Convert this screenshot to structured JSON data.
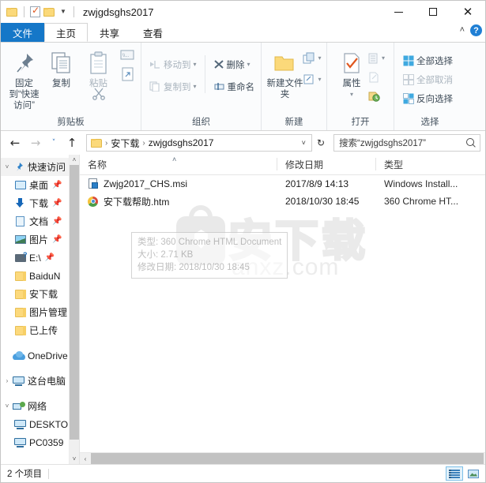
{
  "window": {
    "title": "zwjgdsghs2017",
    "quick_access": [
      "folder-icon",
      "properties-icon",
      "folder-icon"
    ],
    "controls": {
      "minimize": "—",
      "maximize": "□",
      "close": "✕"
    }
  },
  "tabs": [
    {
      "id": "file",
      "label": "文件"
    },
    {
      "id": "home",
      "label": "主页"
    },
    {
      "id": "share",
      "label": "共享"
    },
    {
      "id": "view",
      "label": "查看"
    }
  ],
  "tabstrip_right": {
    "collapse": "˄",
    "help": "?"
  },
  "ribbon": {
    "groups": [
      {
        "id": "clipboard",
        "label": "剪贴板",
        "big_buttons": [
          {
            "id": "pin-to-quick-access",
            "label": "固定到“快速访问”",
            "icon": "pin-icon",
            "dim": false
          },
          {
            "id": "copy",
            "label": "复制",
            "icon": "copy-icon",
            "dim": false
          },
          {
            "id": "paste",
            "label": "粘贴",
            "icon": "paste-icon",
            "dim": true
          }
        ],
        "small_buttons": [
          {
            "id": "cut",
            "label": "",
            "icon": "scissors-icon"
          },
          {
            "id": "copy-path",
            "label": "",
            "icon": "copy-path-icon"
          },
          {
            "id": "paste-shortcut",
            "label": "",
            "icon": "paste-shortcut-icon"
          }
        ]
      },
      {
        "id": "organize",
        "label": "组织",
        "small_buttons": [
          {
            "id": "move-to",
            "label": "移动到",
            "icon": "move-to-icon",
            "caret": "▾",
            "dim": true
          },
          {
            "id": "copy-to",
            "label": "复制到",
            "icon": "copy-to-icon",
            "caret": "▾",
            "dim": true
          },
          {
            "id": "delete",
            "label": "删除",
            "icon": "delete-x-icon",
            "caret": "▾",
            "dim": false
          },
          {
            "id": "rename",
            "label": "重命名",
            "icon": "rename-icon",
            "caret": "",
            "dim": false
          }
        ]
      },
      {
        "id": "new",
        "label": "新建",
        "big_buttons": [
          {
            "id": "new-folder",
            "label": "新建文件夹",
            "icon": "new-folder-icon",
            "dim": false
          }
        ],
        "small_buttons": [
          {
            "id": "new-item",
            "label": "",
            "icon": "new-item-icon",
            "caret": "▾"
          },
          {
            "id": "easy-access",
            "label": "",
            "icon": "easy-access-icon",
            "caret": "▾"
          }
        ]
      },
      {
        "id": "open",
        "label": "打开",
        "big_buttons": [
          {
            "id": "properties",
            "label": "属性",
            "icon": "properties-check-icon",
            "caret": "▾",
            "dim": false
          }
        ],
        "small_buttons": [
          {
            "id": "open-with",
            "label": "",
            "icon": "open-with-icon",
            "caret": "▾",
            "dim": true
          },
          {
            "id": "edit",
            "label": "",
            "icon": "edit-icon",
            "dim": true
          },
          {
            "id": "history",
            "label": "",
            "icon": "history-icon",
            "dim": false
          }
        ]
      },
      {
        "id": "select",
        "label": "选择",
        "small_buttons": [
          {
            "id": "select-all",
            "label": "全部选择",
            "icon": "select-all-icon",
            "dim": false
          },
          {
            "id": "select-none",
            "label": "全部取消",
            "icon": "select-none-icon",
            "dim": true
          },
          {
            "id": "invert-selection",
            "label": "反向选择",
            "icon": "invert-selection-icon",
            "dim": false
          }
        ]
      }
    ]
  },
  "address_bar": {
    "back": "←",
    "forward": "→",
    "recent": "˅",
    "up": "↑",
    "breadcrumbs": [
      "安下载",
      "zwjgdsghs2017"
    ],
    "separator": "›",
    "dropdown_caret": "˅",
    "refresh": "↻",
    "search_placeholder": "搜索“zwjgdsghs2017”",
    "search_value": "搜索“zwjgdsghs2017”"
  },
  "nav_pane": {
    "items": [
      {
        "id": "quick-access",
        "label": "快速访问",
        "icon": "pin-blue-icon",
        "expander": "˅",
        "pinned": false,
        "root": true,
        "selected": true
      },
      {
        "id": "desktop",
        "label": "桌面",
        "icon": "desktop-icon",
        "pinned": true
      },
      {
        "id": "downloads",
        "label": "下载",
        "icon": "download-icon",
        "pinned": true
      },
      {
        "id": "documents",
        "label": "文档",
        "icon": "document-icon",
        "pinned": true
      },
      {
        "id": "pictures",
        "label": "图片",
        "icon": "pictures-icon",
        "pinned": true
      },
      {
        "id": "drive-e",
        "label": "E:\\",
        "icon": "drive-icon",
        "pinned": true
      },
      {
        "id": "baidunetdisk",
        "label": "BaiduN",
        "icon": "folder-icon",
        "pinned": false
      },
      {
        "id": "anxiazai",
        "label": "安下载",
        "icon": "folder-icon",
        "pinned": false
      },
      {
        "id": "image-manage",
        "label": "图片管理",
        "icon": "folder-icon",
        "pinned": false
      },
      {
        "id": "uploaded",
        "label": "已上传",
        "icon": "folder-icon",
        "pinned": false
      },
      {
        "id": "onedrive",
        "label": "OneDrive",
        "icon": "cloud-icon",
        "root": true,
        "gap_before": true
      },
      {
        "id": "this-pc",
        "label": "这台电脑",
        "icon": "pc-icon",
        "expander": "›",
        "root": true,
        "gap_before": true
      },
      {
        "id": "network",
        "label": "网络",
        "icon": "network-icon",
        "expander": "˅",
        "root": true,
        "gap_before": true
      },
      {
        "id": "desktop-pc",
        "label": "DESKTO",
        "icon": "pc-icon"
      },
      {
        "id": "pc0359",
        "label": "PC0359",
        "icon": "pc-icon"
      }
    ],
    "scrollbar": {
      "up": "˄",
      "down": "˅"
    }
  },
  "file_list": {
    "columns": [
      {
        "id": "name",
        "label": "名称",
        "sorted": true,
        "sort_arrow": "˄"
      },
      {
        "id": "date_modified",
        "label": "修改日期"
      },
      {
        "id": "type",
        "label": "类型"
      }
    ],
    "rows": [
      {
        "name": "Zwjg2017_CHS.msi",
        "icon": "msi-installer-icon",
        "date_modified": "2017/8/9 14:13",
        "type": "Windows Install..."
      },
      {
        "name": "安下载帮助.htm",
        "icon": "chrome-html-icon",
        "date_modified": "2018/10/30 18:45",
        "type": "360 Chrome HT..."
      }
    ],
    "tooltip": {
      "lines": [
        "类型: 360 Chrome HTML Document",
        "大小: 2.71 KB",
        "修改日期: 2018/10/30 18:45"
      ]
    },
    "hscrollbar": {
      "left": "‹",
      "right": "›"
    }
  },
  "watermark": {
    "text": "安下载",
    "url": "anxz.com"
  },
  "status_bar": {
    "item_count": "2 个项目",
    "views": [
      {
        "id": "details-view",
        "icon": "details-view-icon",
        "active": true
      },
      {
        "id": "thumbnail-view",
        "icon": "thumbnail-view-icon",
        "active": false
      }
    ]
  },
  "colors": {
    "accent": "#1577c8",
    "ribbon_bg": "#fbfcfd",
    "folder_yellow": "#fcd97c",
    "scroll_thumb": "#c2c2c2"
  }
}
